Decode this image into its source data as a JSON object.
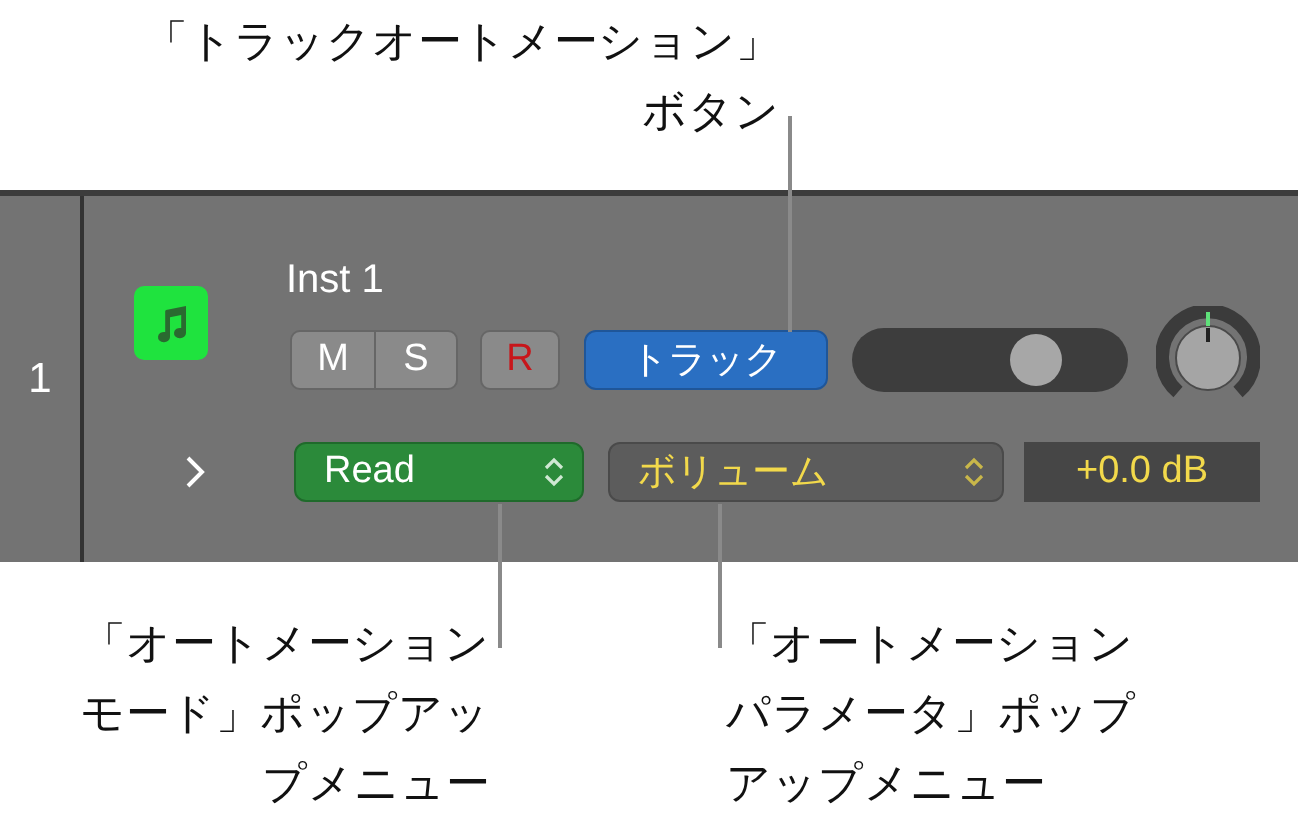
{
  "callouts": [
    {
      "kind": "top",
      "lines": [
        "「トラックオートメーション」",
        "ボタン"
      ]
    },
    {
      "kind": "left",
      "lines": [
        "「オートメーション",
        "モード」ポップアッ",
        "プメニュー"
      ]
    },
    {
      "kind": "right",
      "lines": [
        "「オートメーション",
        "パラメータ」ポップ",
        "アップメニュー"
      ]
    }
  ],
  "track": {
    "number": "1",
    "name": "Inst 1",
    "mute": "M",
    "solo": "S",
    "record": "R",
    "automation_button": "トラック",
    "volume": {
      "level": 0.72
    },
    "automation_mode": "Read",
    "automation_parameter": "ボリューム",
    "value": "+0.0 dB"
  }
}
